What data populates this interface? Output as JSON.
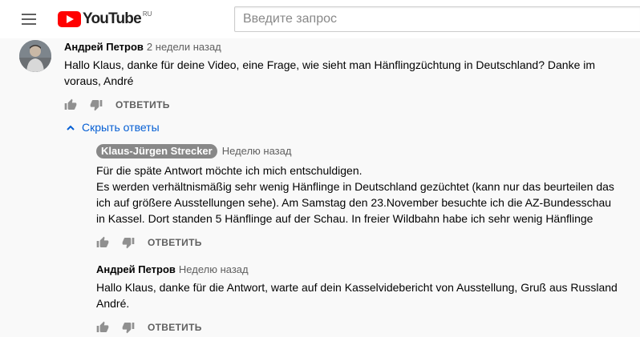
{
  "header": {
    "logo_text": "YouTube",
    "logo_region": "RU",
    "search_placeholder": "Введите запрос"
  },
  "comment": {
    "author": "Андрей Петров",
    "time": "2 недели назад",
    "text": "Hallo Klaus, danke für deine Video, eine Frage, wie sieht man Hänflingzüchtung in Deutschland? Danke im\nvoraus, André",
    "reply_label": "ОТВЕТИТЬ"
  },
  "replies_toggle": {
    "label": "Скрыть ответы"
  },
  "replies": [
    {
      "author": "Klaus-Jürgen Strecker",
      "time": "Неделю назад",
      "text": "Für die späte Antwort möchte ich mich entschuldigen.\nEs werden verhältnismäßig sehr wenig Hänflinge in Deutschland gezüchtet (kann nur das beurteilen das\nich auf größere Ausstellungen sehe). Am Samstag den 23.November besuchte ich die AZ-Bundesschau\nin Kassel. Dort standen 5 Hänflinge auf der Schau. In freier Wildbahn habe ich sehr wenig Hänflinge",
      "reply_label": "ОТВЕТИТЬ"
    },
    {
      "author": "Андрей Петров",
      "time": "Неделю назад",
      "text": "Hallo Klaus, danke für die Antwort, warte auf dein Kasselvidebericht von Ausstellung, Gruß aus Russland\nAndré.",
      "reply_label": "ОТВЕТИТЬ"
    }
  ],
  "colors": {
    "brand_red": "#ff0000",
    "link_blue": "#065fd4",
    "secondary_text": "#606060",
    "icon_gray": "#909090",
    "page_background": "#f9f9f9"
  },
  "icons": [
    "menu-icon",
    "youtube-play-icon",
    "thumbs-up-icon",
    "thumbs-down-icon",
    "chevron-up-icon"
  ]
}
